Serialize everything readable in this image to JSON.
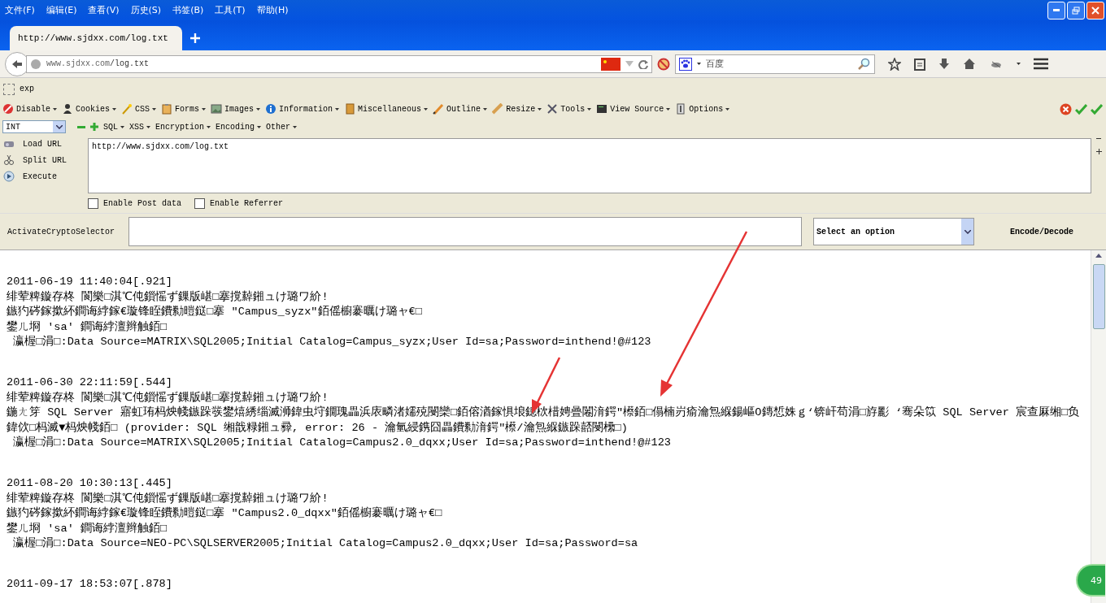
{
  "menu": [
    {
      "label": "文件(F)"
    },
    {
      "label": "编辑(E)"
    },
    {
      "label": "查看(V)"
    },
    {
      "label": "历史(S)"
    },
    {
      "label": "书签(B)"
    },
    {
      "label": "工具(T)"
    },
    {
      "label": "帮助(H)"
    }
  ],
  "tab": {
    "title": "http://www.sjdxx.com/log.txt"
  },
  "address": {
    "host": "www.sjdxx.com",
    "path": "/log.txt"
  },
  "search": {
    "placeholder": "百度"
  },
  "bookmarks": [
    {
      "label": "exp"
    }
  ],
  "hackbar": {
    "menu": [
      {
        "label": "Disable"
      },
      {
        "label": "Cookies"
      },
      {
        "label": "CSS"
      },
      {
        "label": "Forms"
      },
      {
        "label": "Images"
      },
      {
        "label": "Information"
      },
      {
        "label": "Miscellaneous"
      },
      {
        "label": "Outline"
      },
      {
        "label": "Resize"
      },
      {
        "label": "Tools"
      },
      {
        "label": "View Source"
      },
      {
        "label": "Options"
      }
    ],
    "type_select": "INT",
    "sub_menu": [
      {
        "label": "SQL"
      },
      {
        "label": "XSS"
      },
      {
        "label": "Encryption"
      },
      {
        "label": "Encoding"
      },
      {
        "label": "Other"
      }
    ],
    "actions": [
      {
        "label": "Load URL"
      },
      {
        "label": "Split URL"
      },
      {
        "label": "Execute"
      }
    ],
    "url_text": "http://www.sjdxx.com/log.txt",
    "checkboxes": [
      {
        "label": "Enable Post data",
        "checked": false
      },
      {
        "label": "Enable Referrer",
        "checked": false
      }
    ],
    "crypto_label": "ActivateCryptoSelector",
    "crypto_select": "Select an option",
    "encode_button": "Encode/Decode"
  },
  "log": [
    {
      "timestamp": "2011-06-19 11:40:04[.921]",
      "lines": [
        "绯荤粺鏇存柊 閬樂□淇℃伅鎻愮ず鏁版嵁□搴撹繛鎺ュけ璐ワ紒!",
        "鏃犳硶鎵撳紑鐧诲綍鎵€璇锋眰鐨勬暟鎹□搴 \"Campus_syzx\"銆傜櫥褰曞け璐ャ€□",
        "鐢ㄦ埛 'sa' 鐧诲綍澶辫触銆□",
        " 瀛楃□涓□:Data Source=MATRIX\\SQL2005;Initial Catalog=Campus_syzx;User Id=sa;Password=inthend!@#123"
      ]
    },
    {
      "timestamp": "2011-06-30 22:11:59[.544]",
      "lines": [
        "绯荤粺鏇存柊 閬樂□淇℃伅鎻愮ず鏁版嵁□搴撹繛鎺ュけ璐ワ紒!",
        "鍦ㄤ笌 SQL Server 寤虹珛杩炴帴鏃跺彂鐢熺綉缁滅浉鍏虫垨鐗瑰畾浜庡疄渚嬬殑閿欒□銆傛湭鎵惧埌鎴栨棤娉曡闂湇鍔″櫒銆□傝楠岃瘉瀹炰緥鍚嶇О鏄惁姝ｇ‘锛屽苟涓□斿彲 ‘骞朵笖 SQL Server 宸查厤缃□负鍏佽□杩滅▼杩炴帴銆□ (provider: SQL 缃戠粶鎺ュ彛, error: 26 - 瀹氫綅鎸囧畾鐨勬湇鍔″櫒/瀹炰緥鏃跺嚭閿欙□)",
        " 瀛楃□涓□:Data Source=MATRIX\\SQL2005;Initial Catalog=Campus2.0_dqxx;User Id=sa;Password=inthend!@#123"
      ]
    },
    {
      "timestamp": "2011-08-20 10:30:13[.445]",
      "lines": [
        "绯荤粺鏇存柊 閬樂□淇℃伅鎻愮ず鏁版嵁□搴撹繛鎺ュけ璐ワ紒!",
        "鏃犳硶鎵撳紑鐧诲綍鎵€璇锋眰鐨勬暟鎹□搴 \"Campus2.0_dqxx\"銆傜櫥褰曞け璐ャ€□",
        "鐢ㄦ埛 'sa' 鐧诲綍澶辫触銆□",
        " 瀛楃□涓□:Data Source=NEO-PC\\SQLSERVER2005;Initial Catalog=Campus2.0_dqxx;User Id=sa;Password=sa"
      ]
    },
    {
      "timestamp": "2011-09-17 18:53:07[.878]"
    }
  ],
  "badge": "49"
}
